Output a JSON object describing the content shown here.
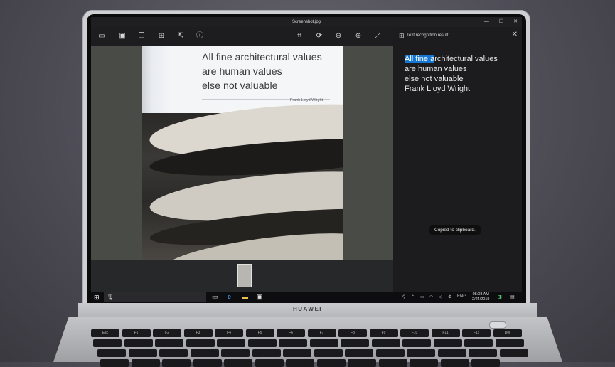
{
  "window": {
    "title": "Screenshot.jpg",
    "controls": [
      "—",
      "☐",
      "✕"
    ]
  },
  "toolbar": {
    "icons": [
      "folder-icon",
      "save-icon",
      "copy-icon",
      "text-recognition-icon",
      "share-icon",
      "info-icon",
      "crop-icon",
      "rotate-icon",
      "zoom-out-icon",
      "zoom-in-icon",
      "fullscreen-icon"
    ],
    "glyphs": [
      "▭",
      "▣",
      "❐",
      "⊞",
      "⇱",
      "ⓘ",
      "⌗",
      "⟳",
      "⊖",
      "⊕",
      "⤢"
    ]
  },
  "image": {
    "quote_lines": [
      "All fine architectural values",
      "are human values",
      "else not valuable"
    ],
    "author": "Frank Lloyd Wright"
  },
  "panel": {
    "title": "Text recognition result",
    "selected_text": "All fine a",
    "result_first_rest": "rchitectural values",
    "result_lines": [
      "are human values",
      "else not valuable",
      "Frank Lloyd Wright"
    ],
    "toast": "Copied to clipboard."
  },
  "taskbar": {
    "language": "ENG",
    "time": "08:08 AM",
    "date": "2/24/2019"
  },
  "laptop": {
    "brand": "HUAWEI"
  },
  "keyboard": {
    "labels": [
      "Esc",
      "F1",
      "F2",
      "F3",
      "F4",
      "F5",
      "F6",
      "F7",
      "F8",
      "F9",
      "F10",
      "F11",
      "F12",
      "Del"
    ]
  }
}
